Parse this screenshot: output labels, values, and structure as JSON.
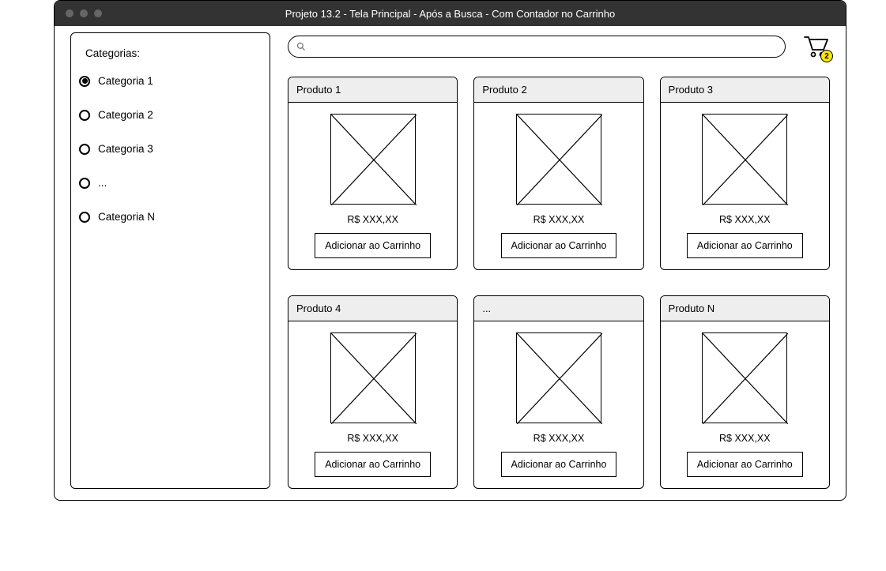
{
  "window": {
    "title": "Projeto 13.2 - Tela Principal - Após a Busca - Com Contador no Carrinho"
  },
  "sidebar": {
    "title": "Categorias:",
    "items": [
      {
        "label": "Categoria 1",
        "selected": true
      },
      {
        "label": "Categoria 2",
        "selected": false
      },
      {
        "label": "Categoria 3",
        "selected": false
      },
      {
        "label": "...",
        "selected": false
      },
      {
        "label": "Categoria N",
        "selected": false
      }
    ]
  },
  "search": {
    "value": "",
    "placeholder": ""
  },
  "cart": {
    "count": "2"
  },
  "products_row1": [
    {
      "name": "Produto 1",
      "price": "R$ XXX,XX",
      "button": "Adicionar ao Carrinho"
    },
    {
      "name": "Produto 2",
      "price": "R$ XXX,XX",
      "button": "Adicionar ao Carrinho"
    },
    {
      "name": "Produto 3",
      "price": "R$ XXX,XX",
      "button": "Adicionar ao Carrinho"
    }
  ],
  "products_row2": [
    {
      "name": "Produto 4",
      "price": "R$ XXX,XX",
      "button": "Adicionar ao Carrinho"
    },
    {
      "name": "...",
      "price": "R$ XXX,XX",
      "button": "Adicionar ao Carrinho"
    },
    {
      "name": "Produto N",
      "price": "R$ XXX,XX",
      "button": "Adicionar ao Carrinho"
    }
  ]
}
